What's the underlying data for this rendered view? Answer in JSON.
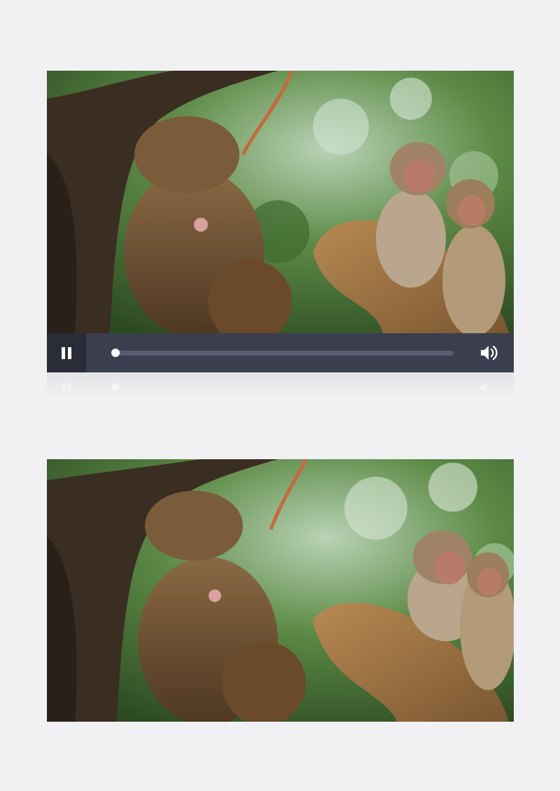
{
  "player": {
    "state": "playing",
    "progress": 0.0,
    "controls": {
      "pause_icon": "pause-icon",
      "volume_icon": "volume-icon"
    }
  },
  "scene": {
    "subject_icon": "monkeys-in-tree-image"
  },
  "colors": {
    "page_bg": "#f1f1f3",
    "control_bar": "#3b3e4f",
    "control_button_bg": "#2a2c38",
    "track": "#5a5d70",
    "knob": "#ffffff"
  }
}
